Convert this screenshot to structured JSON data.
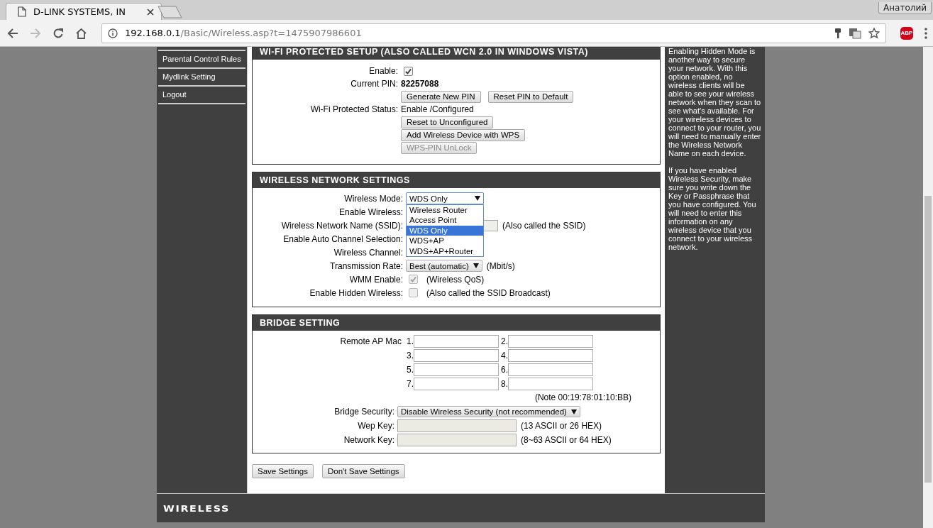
{
  "browser": {
    "tab_title": "D-LINK SYSTEMS, IN",
    "profile": "Анатолий",
    "url_host": "192.168.0.1",
    "url_path": "/Basic/Wireless.asp?t=1475907986601",
    "extension_badge": "ABP"
  },
  "sidebar": {
    "items": [
      {
        "label": "Parental Control Rules",
        "selected": false
      },
      {
        "label": "Mydlink Setting",
        "selected": false
      },
      {
        "label": "Logout",
        "selected": false
      }
    ]
  },
  "wps": {
    "title": "WI-FI PROTECTED SETUP (ALSO CALLED WCN 2.0 IN WINDOWS VISTA)",
    "rows": [
      {
        "kind": "checkbox",
        "label": "Enable:",
        "checked": true,
        "disabled": false
      },
      {
        "kind": "text",
        "label": "Current PIN:",
        "value": "82257088",
        "emphasis": true
      },
      {
        "kind": "buttons",
        "buttons": [
          {
            "label": "Generate New PIN",
            "disabled": false
          },
          {
            "label": "Reset PIN to Default",
            "disabled": false
          }
        ]
      },
      {
        "kind": "text",
        "label": "Wi-Fi Protected Status:",
        "value": "Enable /Configured",
        "emphasis": false
      },
      {
        "kind": "buttons",
        "buttons": [
          {
            "label": "Reset to Unconfigured",
            "disabled": false
          }
        ]
      },
      {
        "kind": "buttons",
        "buttons": [
          {
            "label": "Add Wireless Device with WPS",
            "disabled": false
          }
        ]
      },
      {
        "kind": "buttons",
        "buttons": [
          {
            "label": "WPS-PIN UnLock",
            "disabled": true
          }
        ]
      }
    ]
  },
  "wireless": {
    "title": "WIRELESS NETWORK SETTINGS",
    "rows": [
      {
        "kind": "select",
        "label": "Wireless Mode:",
        "value": "WDS Only",
        "expanded": true,
        "options": [
          {
            "label": "Wireless Router",
            "selected": false
          },
          {
            "label": "Access Point",
            "selected": false
          },
          {
            "label": "WDS Only",
            "selected": true
          },
          {
            "label": "WDS+AP",
            "selected": false
          },
          {
            "label": "WDS+AP+Router",
            "selected": false
          }
        ]
      },
      {
        "kind": "covered",
        "label": "Enable Wireless:"
      },
      {
        "kind": "covered_field",
        "label": "Wireless Network Name (SSID):",
        "note": "(Also called the SSID)"
      },
      {
        "kind": "covered",
        "label": "Enable Auto Channel Selection:"
      },
      {
        "kind": "covered",
        "label": "Wireless Channel:"
      },
      {
        "kind": "select",
        "label": "Transmission Rate:",
        "value": "Best (automatic)",
        "expanded": false,
        "note": "(Mbit/s)"
      },
      {
        "kind": "checkbox",
        "label": "WMM Enable:",
        "checked": true,
        "disabled": true,
        "note": "(Wireless QoS)"
      },
      {
        "kind": "checkbox",
        "label": "Enable Hidden Wireless:",
        "checked": false,
        "disabled": true,
        "note": "(Also called the SSID Broadcast)"
      }
    ]
  },
  "bridge": {
    "title": "BRIDGE SETTING",
    "mac_label": "Remote AP Mac",
    "mac_fields": [
      "1.",
      "2.",
      "3.",
      "4.",
      "5.",
      "6.",
      "7.",
      "8."
    ],
    "mac_note": "(Note 00:19:78:01:10:BB)",
    "rows": [
      {
        "kind": "select",
        "label": "Bridge Security:",
        "value": "Disable Wireless Security (not recommended)",
        "expanded": false
      },
      {
        "kind": "field",
        "label": "Wep Key:",
        "disabled": true,
        "note": "(13 ASCII or 26 HEX)"
      },
      {
        "kind": "field",
        "label": "Network Key:",
        "disabled": true,
        "note": "(8~63 ASCII or 64 HEX)"
      }
    ]
  },
  "actions": [
    {
      "label": "Save Settings",
      "disabled": false
    },
    {
      "label": "Don't Save Settings",
      "disabled": false
    }
  ],
  "help": {
    "paragraphs": [
      "Enabling Hidden Mode is another way to secure your network. With this option enabled, no wireless clients will be able to see your wireless network when they scan to see what's available. For your wireless devices to connect to your router, you will need to manually enter the Wireless Network Name on each device.",
      "If you have enabled Wireless Security, make sure you write down the Key or Passphrase that you have configured. You will need to enter this information on any wireless device that you connect to your wireless network."
    ]
  },
  "footer": {
    "logo": "WIRELESS"
  }
}
